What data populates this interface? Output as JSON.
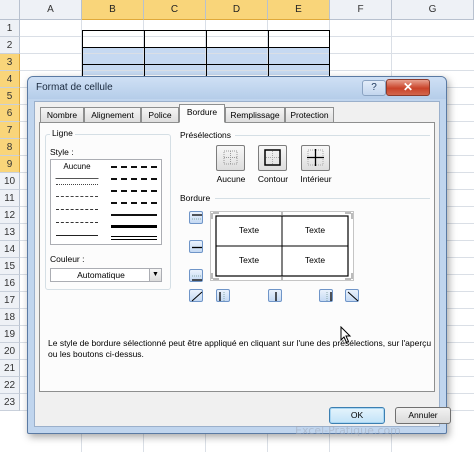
{
  "sheet": {
    "columns": [
      "A",
      "B",
      "C",
      "D",
      "E",
      "F",
      "G"
    ],
    "rows": [
      "1",
      "2",
      "3",
      "4",
      "5",
      "6",
      "7",
      "8",
      "9",
      "10",
      "11",
      "12",
      "13",
      "14",
      "15",
      "16",
      "17",
      "18",
      "19",
      "20",
      "21",
      "22",
      "23"
    ]
  },
  "dialog": {
    "title": "Format de cellule",
    "help_label": "?",
    "close_label": "✕",
    "tabs": [
      {
        "label": "Nombre",
        "active": false
      },
      {
        "label": "Alignement",
        "active": false
      },
      {
        "label": "Police",
        "active": false
      },
      {
        "label": "Bordure",
        "active": true
      },
      {
        "label": "Remplissage",
        "active": false
      },
      {
        "label": "Protection",
        "active": false
      }
    ],
    "line_group": {
      "label": "Ligne",
      "style_label": "Style :",
      "none_option": "Aucune",
      "color_label": "Couleur :",
      "color_value": "Automatique"
    },
    "presets": {
      "label": "Présélections",
      "items": [
        {
          "label": "Aucune",
          "icon": "no-border-icon"
        },
        {
          "label": "Contour",
          "icon": "outline-border-icon"
        },
        {
          "label": "Intérieur",
          "icon": "inside-border-icon"
        }
      ]
    },
    "border_section": {
      "label": "Bordure",
      "preview_texts": [
        "Texte",
        "Texte",
        "Texte",
        "Texte"
      ]
    },
    "help_text": "Le style de bordure sélectionné peut être appliqué en cliquant sur l'une des présélections, sur l'aperçu ou les boutons ci-dessus.",
    "ok_label": "OK",
    "cancel_label": "Annuler",
    "watermark": "Excel-Pratique.com"
  },
  "colors": {
    "selected_header": "#f9d57a",
    "selection_fill": "#c6d9f1",
    "dialog_frame": "#c0d5ee",
    "close_button": "#c9432a"
  }
}
